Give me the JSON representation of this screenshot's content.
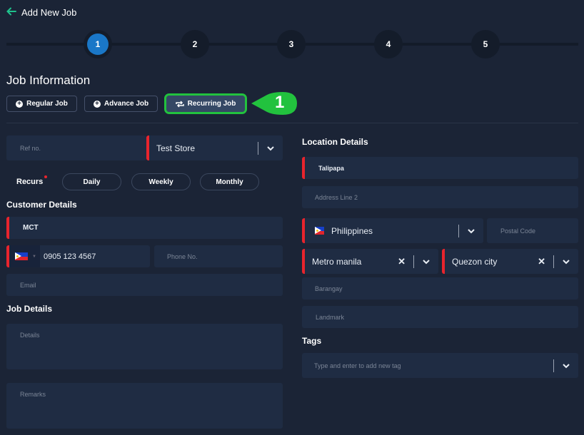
{
  "header": {
    "title": "Add New Job",
    "back_icon": "arrow-left-icon"
  },
  "stepper": {
    "steps": [
      {
        "label": "1",
        "active": true
      },
      {
        "label": "2",
        "active": false
      },
      {
        "label": "3",
        "active": false
      },
      {
        "label": "4",
        "active": false
      },
      {
        "label": "5",
        "active": false
      }
    ]
  },
  "job_information": {
    "title": "Job Information",
    "types": [
      {
        "label": "Regular Job",
        "icon": "plus-circle-icon"
      },
      {
        "label": "Advance Job",
        "icon": "plus-circle-icon"
      },
      {
        "label": "Recurring Job",
        "icon": "repeat-icon",
        "selected": true
      }
    ],
    "callout": {
      "label": "1",
      "color": "#22c23e"
    }
  },
  "left": {
    "ref_no": {
      "placeholder": "Ref no.",
      "value": ""
    },
    "store": {
      "value": "Test Store"
    },
    "recurs": {
      "label": "Recurs",
      "options": [
        "Daily",
        "Weekly",
        "Monthly"
      ]
    },
    "customer": {
      "title": "Customer Details",
      "name": {
        "value": "MCT"
      },
      "country_code": {
        "flag": "philippines-flag-icon"
      },
      "mobile": {
        "value": "0905 123 4567"
      },
      "phone": {
        "placeholder": "Phone No.",
        "value": ""
      },
      "email": {
        "placeholder": "Email",
        "value": ""
      }
    },
    "job_details": {
      "title": "Job Details",
      "details": {
        "placeholder": "Details",
        "value": ""
      },
      "remarks": {
        "placeholder": "Remarks",
        "value": ""
      }
    }
  },
  "right": {
    "location": {
      "title": "Location Details",
      "address1": {
        "value": "Talipapa"
      },
      "address2": {
        "placeholder": "Address Line 2",
        "value": ""
      },
      "country": {
        "value": "Philippines",
        "flag": "philippines-flag-icon"
      },
      "postal": {
        "placeholder": "Postal Code",
        "value": ""
      },
      "region": {
        "value": "Metro manila"
      },
      "city": {
        "value": "Quezon city"
      },
      "barangay": {
        "placeholder": "Barangay",
        "value": ""
      },
      "landmark": {
        "placeholder": "Landmark",
        "value": ""
      }
    },
    "tags": {
      "title": "Tags",
      "placeholder": "Type and enter to add new tag"
    }
  },
  "colors": {
    "background": "#1b2436",
    "field": "#1f2c43",
    "required": "#e8242d",
    "active_step": "#1a77c7",
    "accent_green": "#22c23e",
    "back_arrow": "#1fc28c"
  }
}
